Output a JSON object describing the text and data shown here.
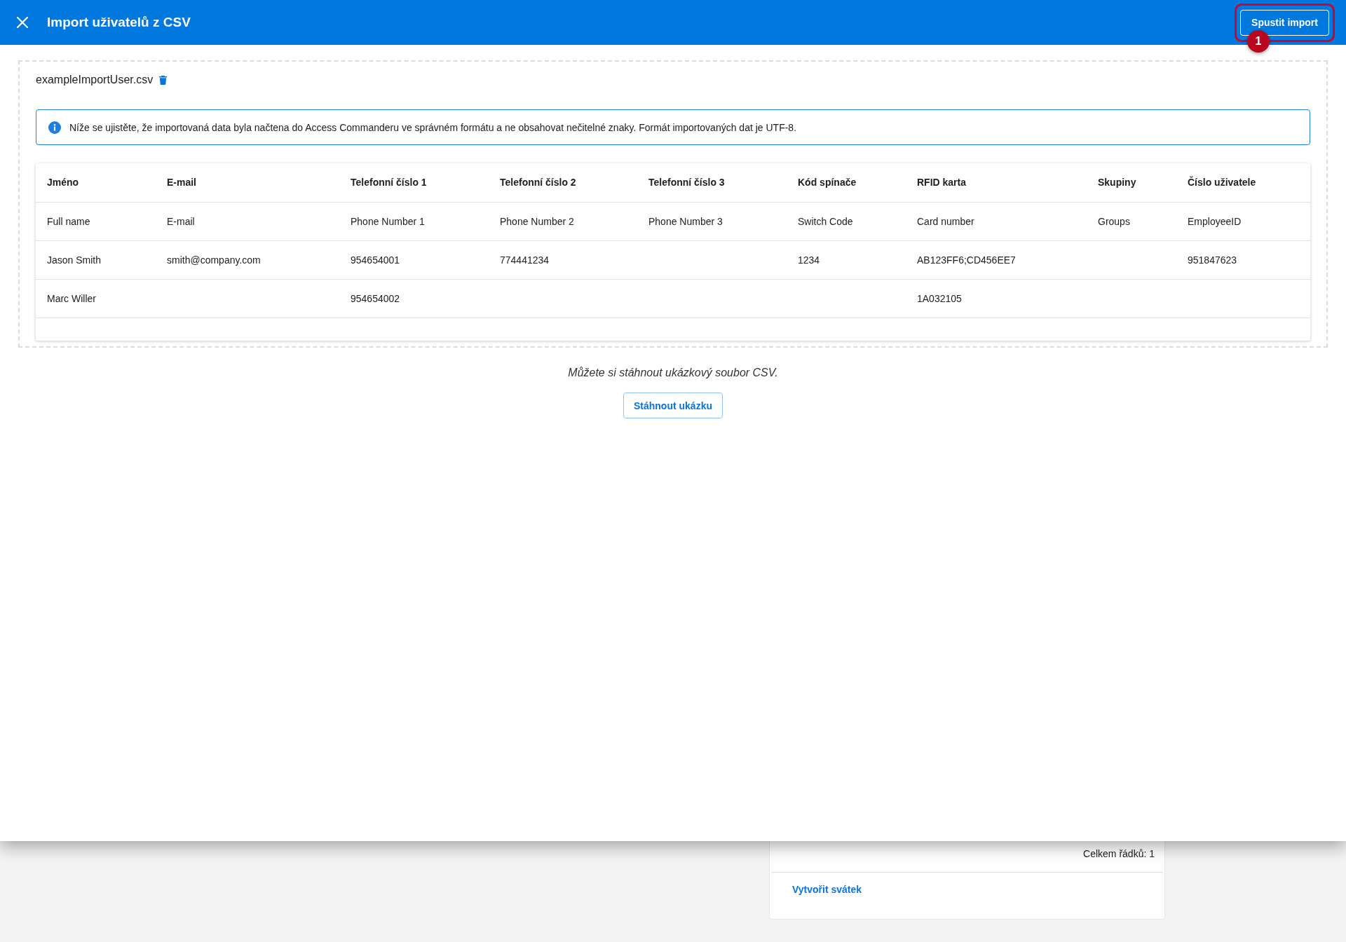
{
  "header": {
    "title": "Import uživatelů z CSV",
    "import_button": "Spustit import"
  },
  "callout": {
    "number": "1"
  },
  "file": {
    "name": "exampleImportUser.csv"
  },
  "info_message": "Níže se ujistěte, že importovaná data byla načtena do Access Commanderu ve správném formátu a ne obsahovat nečitelné znaky. Formát importovaných dat je UTF-8.",
  "table": {
    "columns": [
      "Jméno",
      "E-mail",
      "Telefonní číslo 1",
      "Telefonní číslo 2",
      "Telefonní číslo 3",
      "Kód spínače",
      "RFID karta",
      "Skupiny",
      "Číslo uživatele"
    ],
    "rows": [
      [
        "Full name",
        "E-mail",
        "Phone Number 1",
        "Phone Number 2",
        "Phone Number 3",
        "Switch Code",
        "Card number",
        "Groups",
        "EmployeeID"
      ],
      [
        "Jason Smith",
        "smith@company.com",
        "954654001",
        "774441234",
        null,
        "1234",
        "AB123FF6;CD456EE7",
        null,
        "951847623"
      ],
      [
        "Marc Willer",
        null,
        "954654002",
        null,
        null,
        null,
        "1A032105",
        null,
        null
      ]
    ]
  },
  "sample": {
    "text": "Můžete si stáhnout ukázkový soubor CSV.",
    "button": "Stáhnout ukázku"
  },
  "background_panel": {
    "total": "Celkem řádků: 1",
    "link": "Vytvořit svátek"
  }
}
